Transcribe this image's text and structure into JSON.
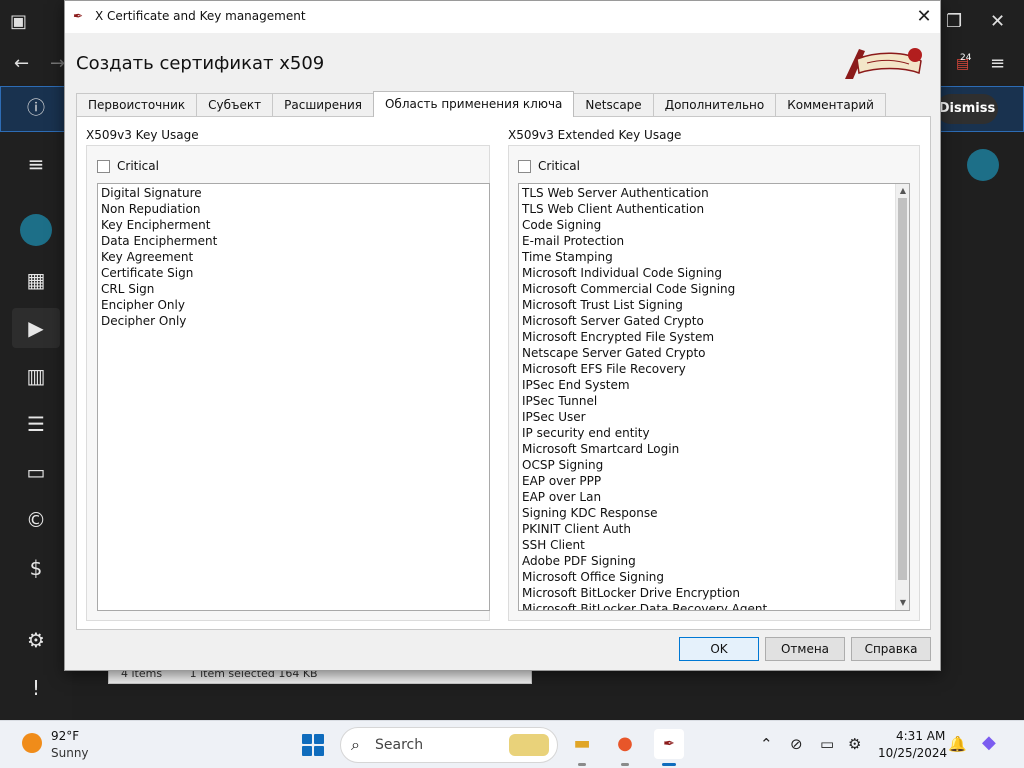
{
  "background": {
    "dismiss_label": "Dismiss",
    "badge": "24",
    "status_items": "4 items",
    "status_selected": "1 item selected  164 KB"
  },
  "dialog": {
    "window_title": "X Certificate and Key management",
    "heading": "Создать сертификат x509",
    "tabs": [
      {
        "label": "Первоисточник"
      },
      {
        "label": "Субъект"
      },
      {
        "label": "Расширения"
      },
      {
        "label": "Область применения ключа"
      },
      {
        "label": "Netscape"
      },
      {
        "label": "Дополнительно"
      },
      {
        "label": "Комментарий"
      }
    ],
    "key_usage": {
      "title": "X509v3 Key Usage",
      "critical_label": "Critical",
      "items": [
        "Digital Signature",
        "Non Repudiation",
        "Key Encipherment",
        "Data Encipherment",
        "Key Agreement",
        "Certificate Sign",
        "CRL Sign",
        "Encipher Only",
        "Decipher Only"
      ]
    },
    "extended_key_usage": {
      "title": "X509v3 Extended Key Usage",
      "critical_label": "Critical",
      "items": [
        "TLS Web Server Authentication",
        "TLS Web Client Authentication",
        "Code Signing",
        "E-mail Protection",
        "Time Stamping",
        "Microsoft Individual Code Signing",
        "Microsoft Commercial Code Signing",
        "Microsoft Trust List Signing",
        "Microsoft Server Gated Crypto",
        "Microsoft Encrypted File System",
        "Netscape Server Gated Crypto",
        "Microsoft EFS File Recovery",
        "IPSec End System",
        "IPSec Tunnel",
        "IPSec User",
        "IP security end entity",
        "Microsoft Smartcard Login",
        "OCSP Signing",
        "EAP over PPP",
        "EAP over Lan",
        "Signing KDC Response",
        "PKINIT Client Auth",
        "SSH Client",
        "Adobe PDF Signing",
        "Microsoft Office Signing",
        "Microsoft BitLocker Drive Encryption",
        "Microsoft BitLocker Data Recovery Agent"
      ]
    },
    "buttons": {
      "ok": "OK",
      "cancel": "Отмена",
      "help": "Справка"
    }
  },
  "taskbar": {
    "weather_temp": "92°F",
    "weather_condition": "Sunny",
    "search_label": "Search",
    "time": "4:31 AM",
    "date": "10/25/2024"
  },
  "colors": {
    "accent": "#0078d4",
    "dialog_bg": "#f0f0f0",
    "background_app": "#1f1f1f"
  }
}
